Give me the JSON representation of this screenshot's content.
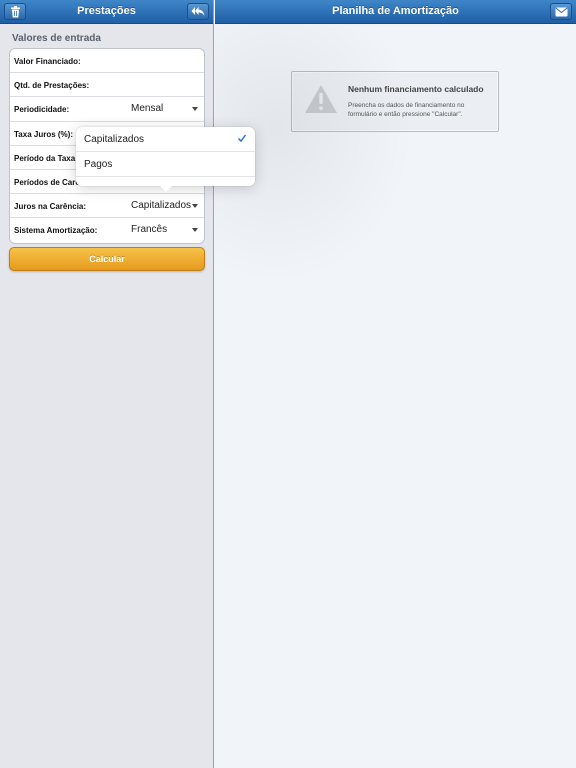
{
  "left": {
    "title": "Prestações",
    "section_title": "Valores de entrada",
    "fields": [
      {
        "label": "Valor Financiado:",
        "value": ""
      },
      {
        "label": "Qtd. de Prestações:",
        "value": ""
      },
      {
        "label": "Periodicidade:",
        "value": "Mensal"
      },
      {
        "label": "Taxa Juros (%):",
        "value": ""
      },
      {
        "label": "Período da Taxa:",
        "value": ""
      },
      {
        "label": "Períodos de Carência:",
        "value": ""
      },
      {
        "label": "Juros na Carência:",
        "value": "Capitalizados"
      },
      {
        "label": "Sistema Amortização:",
        "value": "Francês"
      }
    ],
    "calc_label": "Calcular"
  },
  "right": {
    "title": "Planilha de Amortização",
    "message_title": "Nenhum financiamento calculado",
    "message_body": "Preencha os dados de financiamento no formulário e então pressione \"Calcular\"."
  },
  "popover": {
    "options": [
      {
        "label": "Capitalizados",
        "selected": true
      },
      {
        "label": "Pagos",
        "selected": false
      }
    ]
  },
  "icons": {
    "trash": "trash-icon",
    "reply": "reply-all-icon",
    "mail": "mail-icon",
    "warning": "warning-icon",
    "check": "checkmark-icon",
    "caret": "caret-down-icon"
  },
  "colors": {
    "navbar": "#2a6db3",
    "button": "#eda72b",
    "check": "#1f6fc9"
  }
}
